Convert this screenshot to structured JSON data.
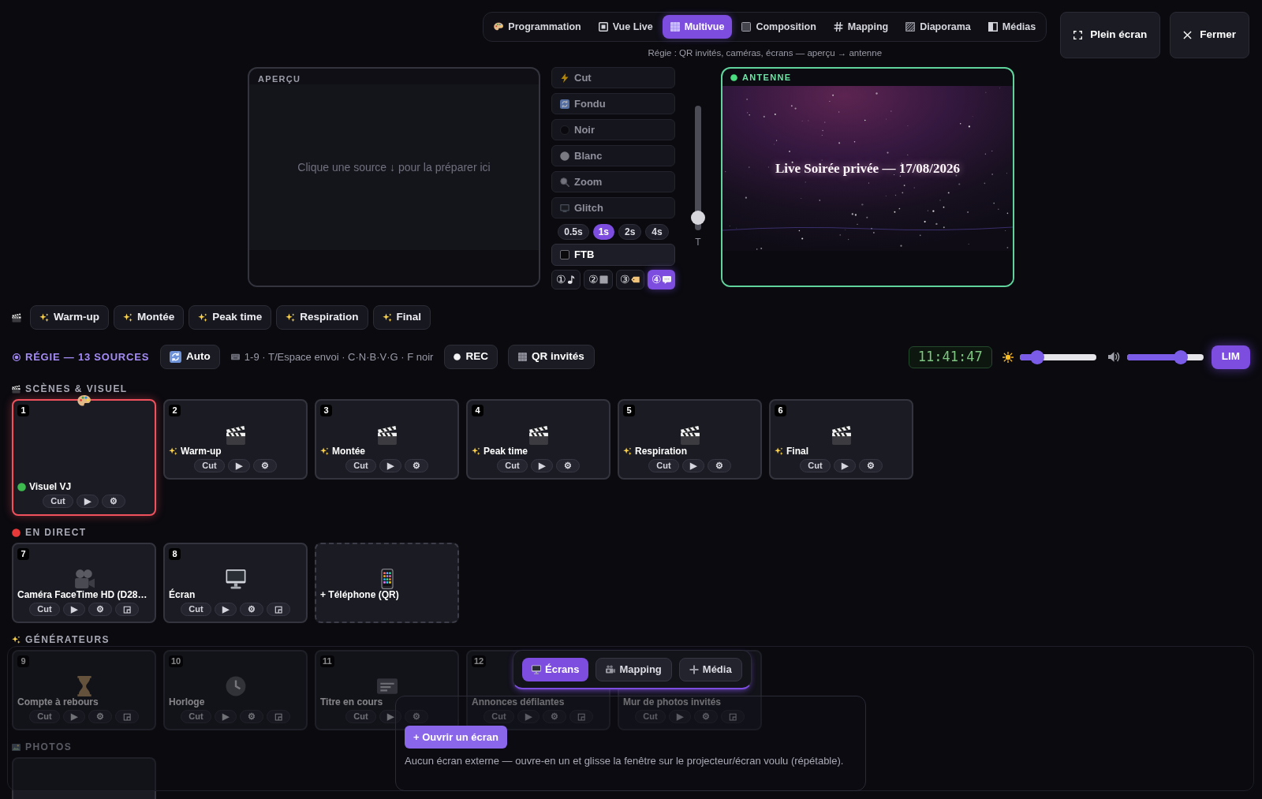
{
  "header": {
    "tabs": [
      {
        "label": "Programmation",
        "selected": false
      },
      {
        "label": "Vue Live",
        "selected": false
      },
      {
        "label": "Multivue",
        "selected": true
      },
      {
        "label": "Composition",
        "selected": false
      },
      {
        "label": "Mapping",
        "selected": false
      },
      {
        "label": "Diaporama",
        "selected": false
      },
      {
        "label": "Médias",
        "selected": false
      }
    ],
    "subtitle": "Régie : QR invités, caméras, écrans — aperçu → antenne",
    "buttons": [
      {
        "label": "Plein écran",
        "kind": "fullscreen"
      },
      {
        "label": "Fermer",
        "kind": "close"
      }
    ]
  },
  "preview": {
    "title": "APERÇU",
    "placeholder": "Clique une source ↓ pour la préparer ici"
  },
  "transitions": {
    "effects": [
      "Cut",
      "Fondu",
      "Noir",
      "Blanc",
      "Zoom",
      "Glitch"
    ],
    "durations": [
      {
        "label": "0.5s",
        "selected": false
      },
      {
        "label": "1s",
        "selected": true
      },
      {
        "label": "2s",
        "selected": false
      },
      {
        "label": "4s",
        "selected": false
      }
    ],
    "fade_to_black": "FTB",
    "presets": [
      {
        "label": "①",
        "selected": false
      },
      {
        "label": "②",
        "selected": false
      },
      {
        "label": "③",
        "selected": false
      },
      {
        "label": "④",
        "selected": true
      }
    ]
  },
  "tbar": {
    "label": "T",
    "level": 0.05
  },
  "antenna": {
    "title": "ANTENNE",
    "overlay_text": "Live Soirée privée — 17/08/2026"
  },
  "scene_bar": [
    "Warm-up",
    "Montée",
    "Peak time",
    "Respiration",
    "Final"
  ],
  "control_bar": {
    "title": "RÉGIE — 13 SOURCES",
    "auto": "Auto",
    "shortcuts": "1-9 · T/Espace envoi · C·N·B·V·G · F noir",
    "rec": {
      "label": "REC",
      "on": false
    },
    "qr": "QR invités",
    "clock": "11:41:47",
    "brightness": {
      "level": 0.23
    },
    "volume": {
      "level": 0.7
    },
    "limiter": {
      "label": "LIM",
      "on": true
    }
  },
  "sections": [
    {
      "title": "SCÈNES & VISUEL",
      "kind": "scenes",
      "cards": [
        {
          "number": "1",
          "kind": "visual",
          "label": "Visuel VJ",
          "live": true,
          "buttons": [
            "Cut",
            "▶",
            "⚙"
          ]
        },
        {
          "number": "2",
          "kind": "scene",
          "label": "Warm-up",
          "live": false,
          "buttons": [
            "Cut",
            "▶",
            "⚙"
          ]
        },
        {
          "number": "3",
          "kind": "scene",
          "label": "Montée",
          "live": false,
          "buttons": [
            "Cut",
            "▶",
            "⚙"
          ]
        },
        {
          "number": "4",
          "kind": "scene",
          "label": "Peak time",
          "live": false,
          "buttons": [
            "Cut",
            "▶",
            "⚙"
          ]
        },
        {
          "number": "5",
          "kind": "scene",
          "label": "Respiration",
          "live": false,
          "buttons": [
            "Cut",
            "▶",
            "⚙"
          ]
        },
        {
          "number": "6",
          "kind": "scene",
          "label": "Final",
          "live": false,
          "buttons": [
            "Cut",
            "▶",
            "⚙"
          ]
        }
      ]
    },
    {
      "title": "EN DIRECT",
      "kind": "live",
      "cards": [
        {
          "number": "7",
          "kind": "camera",
          "label": "Caméra FaceTime HD (D28…",
          "live": false,
          "buttons": [
            "Cut",
            "▶",
            "⚙",
            "◲"
          ]
        },
        {
          "number": "8",
          "kind": "screen",
          "label": "Écran",
          "live": false,
          "buttons": [
            "Cut",
            "▶",
            "⚙",
            "◲"
          ]
        },
        {
          "kind": "add",
          "label": "+ Téléphone (QR)",
          "live": false
        }
      ]
    },
    {
      "title": "GÉNÉRATEURS",
      "kind": "generators",
      "cards": [
        {
          "number": "9",
          "kind": "countdown",
          "label": "Compte à rebours",
          "live": false,
          "buttons": [
            "Cut",
            "▶",
            "⚙",
            "◲"
          ]
        },
        {
          "number": "10",
          "kind": "clock",
          "label": "Horloge",
          "live": false,
          "buttons": [
            "Cut",
            "▶",
            "⚙",
            "◲"
          ]
        },
        {
          "number": "11",
          "kind": "title",
          "label": "Titre en cours",
          "live": false,
          "buttons": [
            "Cut",
            "▶",
            "⚙"
          ]
        },
        {
          "number": "12",
          "kind": "ticker",
          "label": "Annonces défilantes",
          "live": false,
          "buttons": [
            "Cut",
            "▶",
            "⚙",
            "◲"
          ]
        },
        {
          "kind": "photowall",
          "label": "Mur de photos invités",
          "live": false,
          "buttons": [
            "Cut",
            "▶",
            "⚙",
            "◲"
          ]
        }
      ]
    },
    {
      "title": "PHOTOS",
      "kind": "photos",
      "cards": [
        {
          "kind": "upload",
          "live": false
        }
      ]
    }
  ],
  "overlay": {
    "tabs": [
      {
        "label": "Écrans",
        "selected": true
      },
      {
        "label": "Mapping",
        "selected": false
      },
      {
        "label": "Média",
        "selected": false
      }
    ],
    "open_button": "+ Ouvrir un écran",
    "message": "Aucun écran externe — ouvre-en un et glisse la fenêtre sur le projecteur/écran voulu (répétable)."
  }
}
